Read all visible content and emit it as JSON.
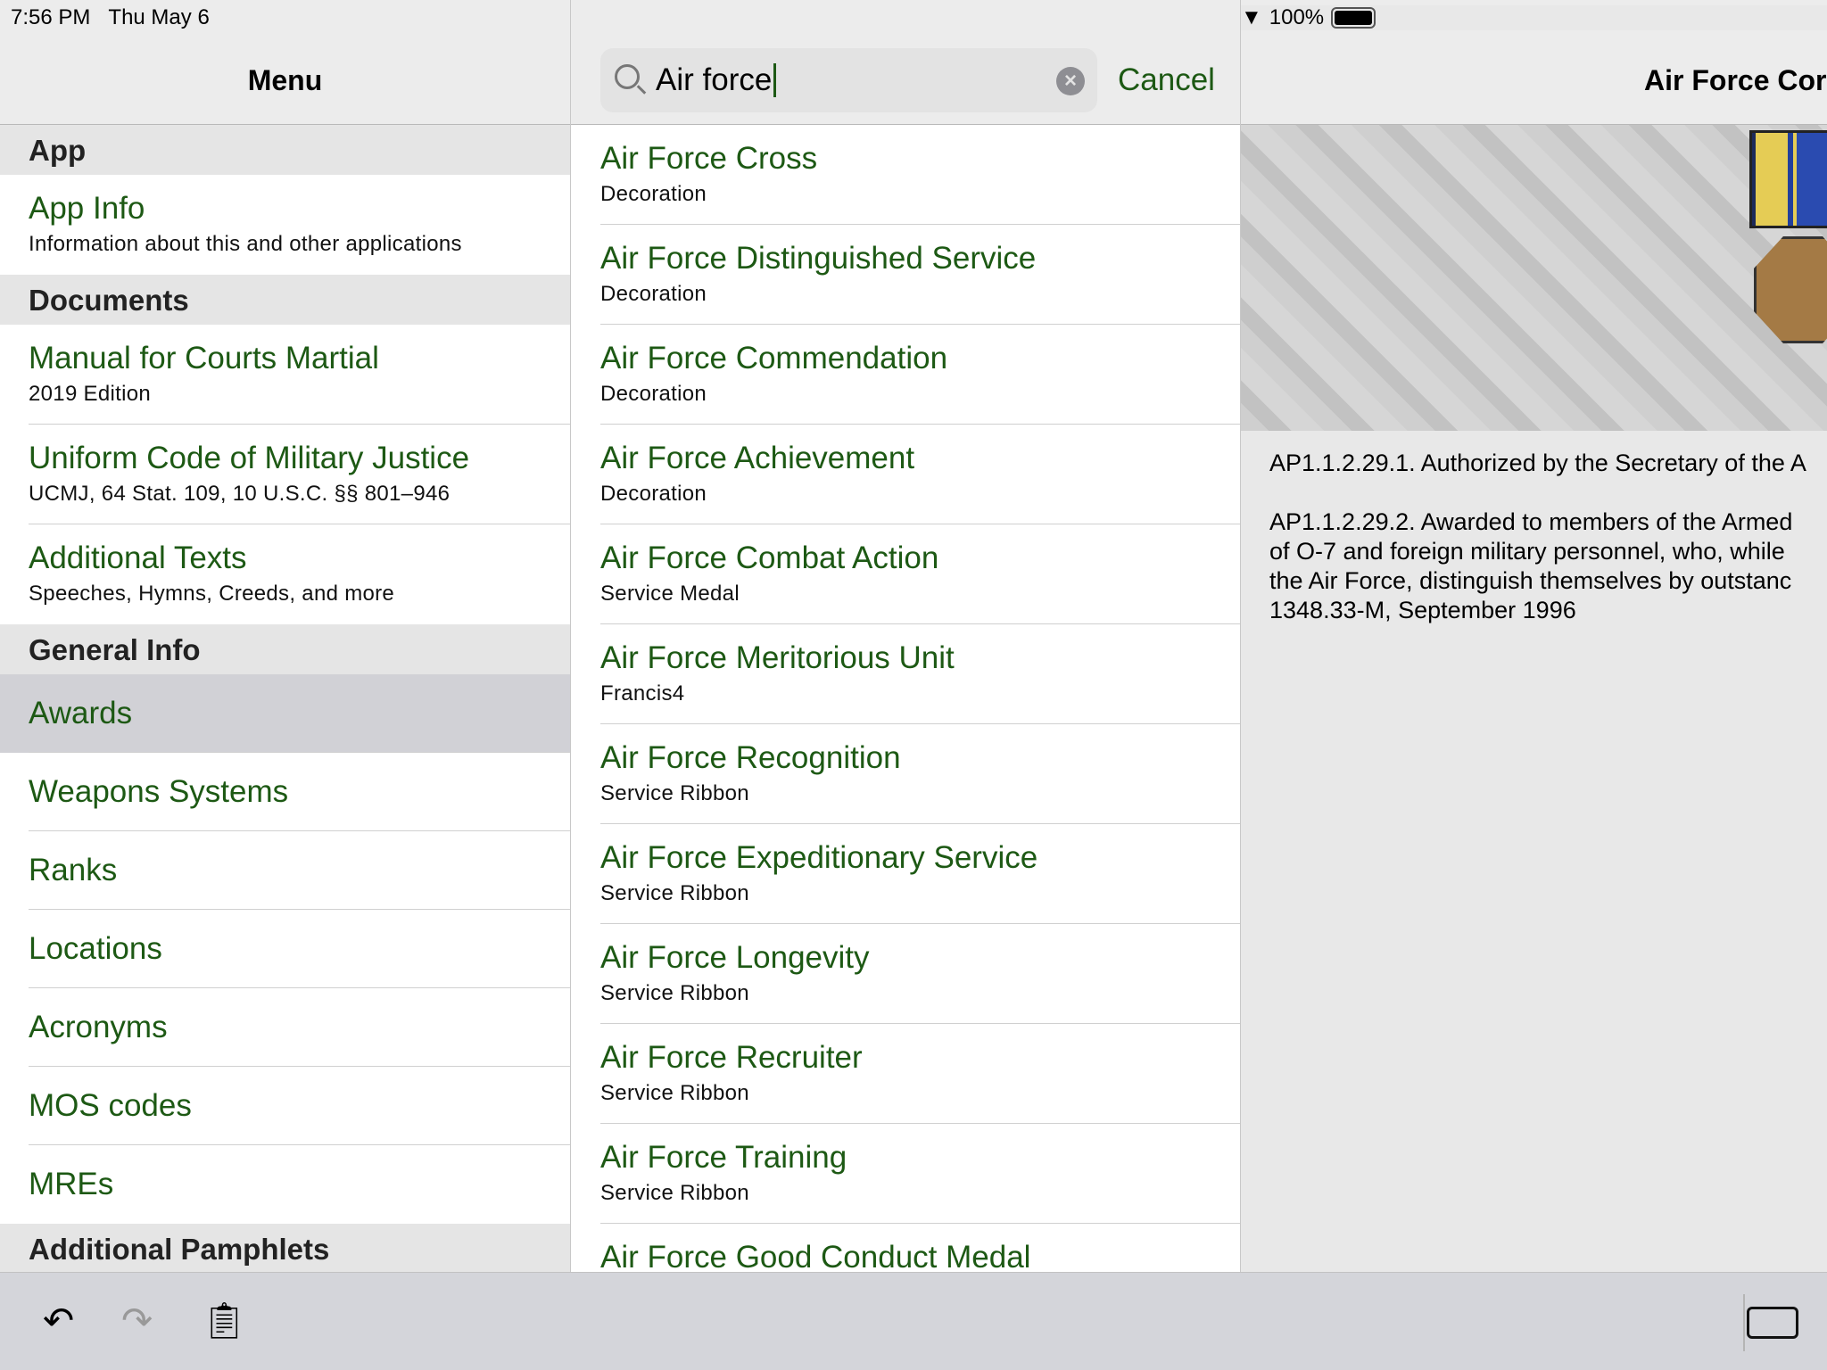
{
  "status": {
    "time": "7:56 PM",
    "date": "Thu May 6",
    "battery": "100%"
  },
  "menu": {
    "title": "Menu",
    "sections": [
      {
        "header": "App",
        "items": [
          {
            "title": "App Info",
            "subtitle": "Information about this and other applications"
          }
        ]
      },
      {
        "header": "Documents",
        "items": [
          {
            "title": "Manual for Courts Martial",
            "subtitle": "2019 Edition"
          },
          {
            "title": "Uniform Code of Military Justice",
            "subtitle": "UCMJ, 64 Stat. 109, 10 U.S.C. §§ 801–946"
          },
          {
            "title": "Additional Texts",
            "subtitle": "Speeches, Hymns, Creeds, and more"
          }
        ]
      },
      {
        "header": "General Info",
        "items": [
          {
            "title": "Awards"
          },
          {
            "title": "Weapons Systems"
          },
          {
            "title": "Ranks"
          },
          {
            "title": "Locations"
          },
          {
            "title": "Acronyms"
          },
          {
            "title": "MOS codes"
          },
          {
            "title": "MREs"
          }
        ]
      },
      {
        "header": "Additional Pamphlets"
      }
    ]
  },
  "search": {
    "value": "Air force",
    "cancel": "Cancel",
    "results": [
      {
        "title": "Air Force Cross",
        "subtitle": "Decoration"
      },
      {
        "title": "Air Force Distinguished Service",
        "subtitle": "Decoration"
      },
      {
        "title": "Air Force Commendation",
        "subtitle": "Decoration"
      },
      {
        "title": "Air Force Achievement",
        "subtitle": "Decoration"
      },
      {
        "title": "Air Force Combat Action",
        "subtitle": "Service Medal"
      },
      {
        "title": "Air Force Meritorious Unit",
        "subtitle": "Francis4"
      },
      {
        "title": "Air Force Recognition",
        "subtitle": "Service Ribbon"
      },
      {
        "title": "Air Force Expeditionary Service",
        "subtitle": "Service Ribbon"
      },
      {
        "title": "Air Force Longevity",
        "subtitle": "Service Ribbon"
      },
      {
        "title": "Air Force Recruiter",
        "subtitle": "Service Ribbon"
      },
      {
        "title": "Air Force Training",
        "subtitle": "Service Ribbon"
      },
      {
        "title": "Air Force Good Conduct Medal",
        "subtitle": ""
      }
    ]
  },
  "detail": {
    "title": "Air Force Cor",
    "p1": "AP1.1.2.29.1. Authorized by the Secretary of the A",
    "p2": [
      "AP1.1.2.29.2. Awarded to members of the Armed",
      "of O-7 and foreign military personnel, who, while",
      "the Air Force, distinguish themselves by outstanc",
      "1348.33-M, September 1996"
    ]
  },
  "colors": {
    "accent": "#1d5914",
    "selected": "#d1d1d6"
  }
}
